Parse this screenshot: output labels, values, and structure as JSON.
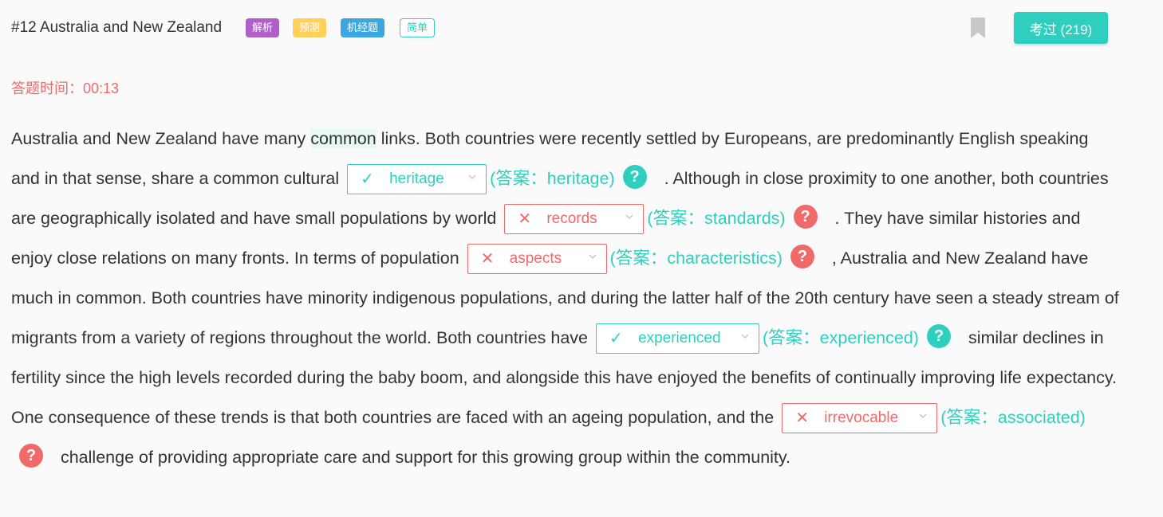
{
  "header": {
    "title": "#12 Australia and New Zealand",
    "tags": [
      "解析",
      "预测",
      "机经题",
      "简单"
    ],
    "taken_label": "考过 (219)"
  },
  "timer": "答题时间：00:13",
  "passage": {
    "p1": "Australia and New Zealand have many ",
    "p1_highlight": "common",
    "p2": " links. Both countries were recently settled by Europeans, are predominantly English speaking and in that sense, share a common cultural",
    "p3": " . Although in close proximity to one another, both countries are geographically isolated and have small populations by world",
    "p4": " . They have similar histories and enjoy close relations on many fronts. In terms of population",
    "p5": " , Australia and New Zealand have much in common. Both countries have minority indigenous populations, and during the latter half of the 20th century have seen a steady stream of migrants from a variety of regions throughout the world. Both countries have",
    "p6": " similar declines in fertility since the high levels recorded during the baby boom, and alongside this have enjoyed the benefits of continually improving life expectancy. One consequence of these trends is that both countries are faced with an ageing population, and the",
    "p7": " challenge of providing appropriate care and support for this growing group within the community."
  },
  "blanks": [
    {
      "value": "heritage",
      "answer": "(答案：heritage)",
      "correct": true,
      "mark": "✓"
    },
    {
      "value": "records",
      "answer": "(答案：standards)",
      "correct": false,
      "mark": "✕"
    },
    {
      "value": "aspects",
      "answer": "(答案：characteristics)",
      "correct": false,
      "mark": "✕"
    },
    {
      "value": "experienced",
      "answer": "(答案：experienced)",
      "correct": true,
      "mark": "✓"
    },
    {
      "value": "irrevocable",
      "answer": "(答案：associated)",
      "correct": false,
      "mark": "✕"
    }
  ],
  "help_glyph": "?",
  "colors": {
    "accent": "#2ecfbf",
    "error": "#f06a6a"
  }
}
